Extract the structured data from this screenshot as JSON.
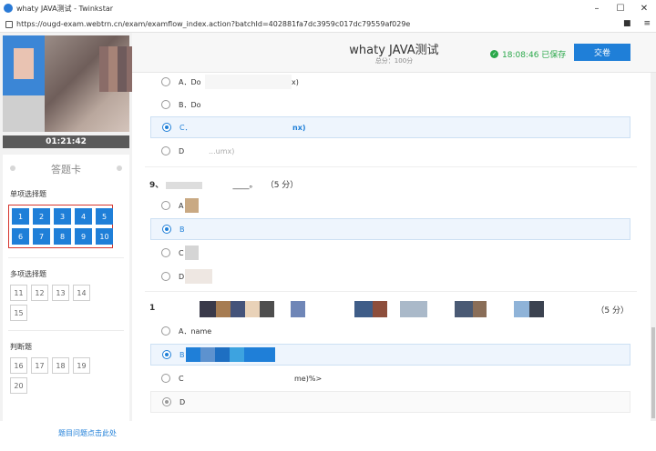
{
  "window": {
    "title": "whaty JAVA测试 - Twinkstar",
    "url": "https://ougd-exam.webtrn.cn/exam/examflow_index.action?batchId=402881fa7dc3959c017dc79559af029e"
  },
  "left": {
    "timer": "01:21:42",
    "card_title": "答题卡",
    "single_label": "单项选择题",
    "single": [
      "1",
      "2",
      "3",
      "4",
      "5",
      "6",
      "7",
      "8",
      "9",
      "10"
    ],
    "multi_label": "多项选择题",
    "multi": [
      "11",
      "12",
      "13",
      "14",
      "15"
    ],
    "judge_label": "判断题",
    "judge": [
      "16",
      "17",
      "18",
      "19",
      "20"
    ],
    "footer_link": "题目问题点击此处"
  },
  "header": {
    "title": "whaty JAVA测试",
    "score": "总分：100分",
    "saved": "18:08:46 已保存",
    "submit": "交卷"
  },
  "q8": {
    "a": "A．Do",
    "a_tail": "x)",
    "b": "B．Do",
    "c": "C．",
    "c_tail": "nx)",
    "d": "D",
    "d_tail": "...umx)"
  },
  "q9": {
    "title": "9、",
    "blank": "____。",
    "points": "（5 分）",
    "a": "A",
    "b": "B",
    "c": "C",
    "d": "D"
  },
  "q10": {
    "title": "1",
    "points": "（5 分）",
    "a": "A．name",
    "b": "B",
    "c": "C",
    "c_tail": "me)%>",
    "d": "D"
  },
  "colors": {
    "accent": "#1f7fd8",
    "saved": "#2aa84a",
    "highlight": "#d6352d"
  }
}
